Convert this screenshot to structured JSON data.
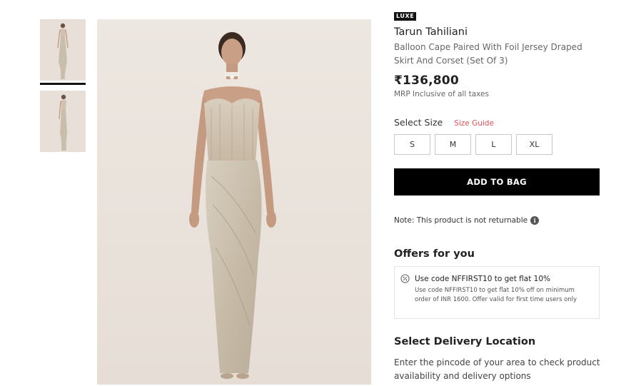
{
  "gallery": {
    "thumbnails": [
      "thumbnail-1",
      "thumbnail-2"
    ],
    "selected_index": 0
  },
  "product": {
    "badge": "LUXE",
    "brand": "Tarun Tahiliani",
    "name": "Balloon Cape Paired With Foil Jersey Draped Skirt And Corset (Set Of 3)",
    "price": "₹136,800",
    "mrp_note": "MRP Inclusive of all taxes"
  },
  "size": {
    "label": "Select Size",
    "guide_link": "Size Guide",
    "options": [
      "S",
      "M",
      "L",
      "XL"
    ]
  },
  "actions": {
    "add_to_bag": "ADD TO BAG"
  },
  "return_note": "Note: This product is not returnable",
  "offers": {
    "title": "Offers for you",
    "items": [
      {
        "code_text": "Use code NFFIRST10 to get flat 10%",
        "description": "Use code NFFIRST10 to get flat 10% off on minimum order of INR 1600. Offer valid for first time users only"
      }
    ]
  },
  "delivery": {
    "title": "Select Delivery Location",
    "text": "Enter the pincode of your area to check product availability and delivery options"
  },
  "colors": {
    "accent": "#e0525b",
    "button_bg": "#000000",
    "image_bg": "#ebe5df"
  }
}
